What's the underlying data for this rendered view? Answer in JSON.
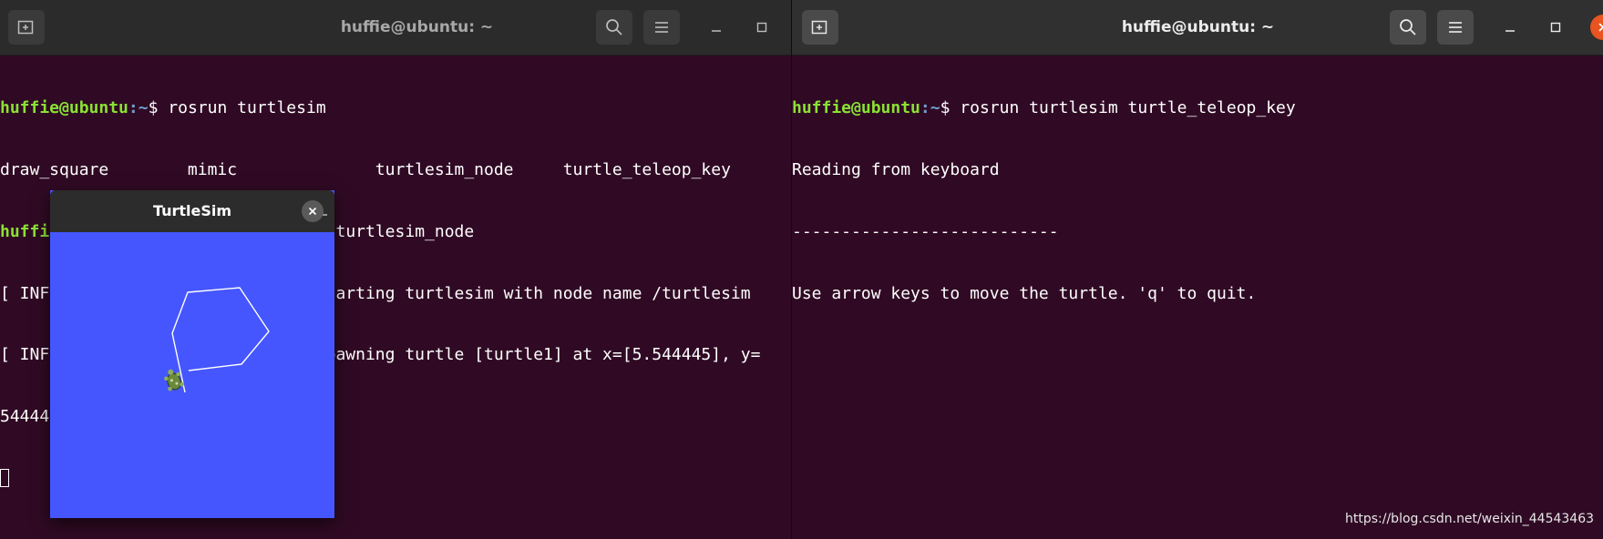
{
  "left_terminal": {
    "title": "huffie@ubuntu: ~",
    "prompt_user": "huffie@ubuntu",
    "prompt_path": ":~",
    "prompt_symbol": "$ ",
    "cmd1": "rosrun turtlesim",
    "completion": "draw_square        mimic              turtlesim_node     turtle_teleop_key",
    "cmd2": "rosrun turtlesim turtlesim_node",
    "log1": "[ INFO] [1613984422.759599853]: Starting turtlesim with node name /turtlesim",
    "log2": "[ INFO] [1613984422.763577246]: Spawning turtle [turtle1] at x=[5.544445], y=",
    "log3": "544445], theta=[0.000000]"
  },
  "right_terminal": {
    "title": "huffie@ubuntu: ~",
    "prompt_user": "huffie@ubuntu",
    "prompt_path": ":~",
    "prompt_symbol": "$ ",
    "cmd": "rosrun turtlesim turtle_teleop_key",
    "out1": "Reading from keyboard",
    "out2": "---------------------------",
    "out3": "Use arrow keys to move the turtle. 'q' to quit."
  },
  "turtlesim": {
    "title": "TurtleSim",
    "background_color": "#4556ff",
    "path_color": "#ffffff"
  },
  "icons": {
    "new_tab": "new-tab-icon",
    "search": "search-icon",
    "menu": "hamburger-menu-icon",
    "minimize": "minimize-icon",
    "maximize": "maximize-icon",
    "close": "close-icon"
  },
  "watermark": "https://blog.csdn.net/weixin_44543463"
}
